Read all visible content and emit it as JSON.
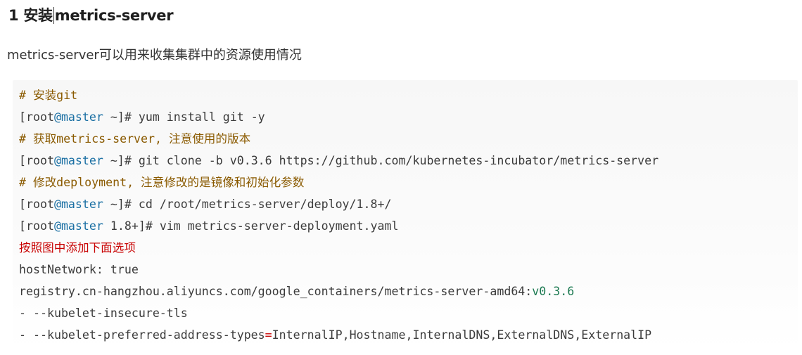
{
  "heading": {
    "number": "1",
    "text_before_cursor": "安装",
    "text_after_cursor": "metrics-server"
  },
  "intro": "metrics-server可以用来收集集群中的资源使用情况",
  "code": {
    "l1": "# 安装git",
    "l2_prompt_a": "[root",
    "l2_at": "@master",
    "l2_prompt_b": " ~]# ",
    "l2_cmd": "yum install git -y",
    "l3": "# 获取metrics-server, 注意使用的版本",
    "l4_prompt_a": "[root",
    "l4_at": "@master",
    "l4_prompt_b": " ~]# ",
    "l4_cmd": "git clone -b v0.3.6 https://github.com/kubernetes-incubator/metrics-server",
    "l5": "# 修改deployment, 注意修改的是镜像和初始化参数",
    "l6_prompt_a": "[root",
    "l6_at": "@master",
    "l6_prompt_b": " ~]# ",
    "l6_cmd": "cd /root/metrics-server/deploy/1.8+/",
    "l7_prompt_a": "[root",
    "l7_at": "@master",
    "l7_prompt_b": " 1.8+]# ",
    "l7_cmd": "vim metrics-server-deployment.yaml",
    "l8": "按照图中添加下面选项",
    "l9_key": "hostNetwork: ",
    "l9_val": "true",
    "l10_a": "registry.cn-hangzhou.aliyuncs.com/google_containers/metrics-server-amd64:",
    "l10_b": "v0.3.6",
    "l11": "- --kubelet-insecure-tls",
    "l12_a": "- --kubelet-preferred-address-types",
    "l12_eq": "=",
    "l12_b": "InternalIP,Hostname,InternalDNS,ExternalDNS,ExternalIP"
  },
  "colors": {
    "comment": "#8a5a00",
    "instruction": "#c80000",
    "host_highlight": "#1a6fa3",
    "version_highlight": "#1d7a52"
  }
}
